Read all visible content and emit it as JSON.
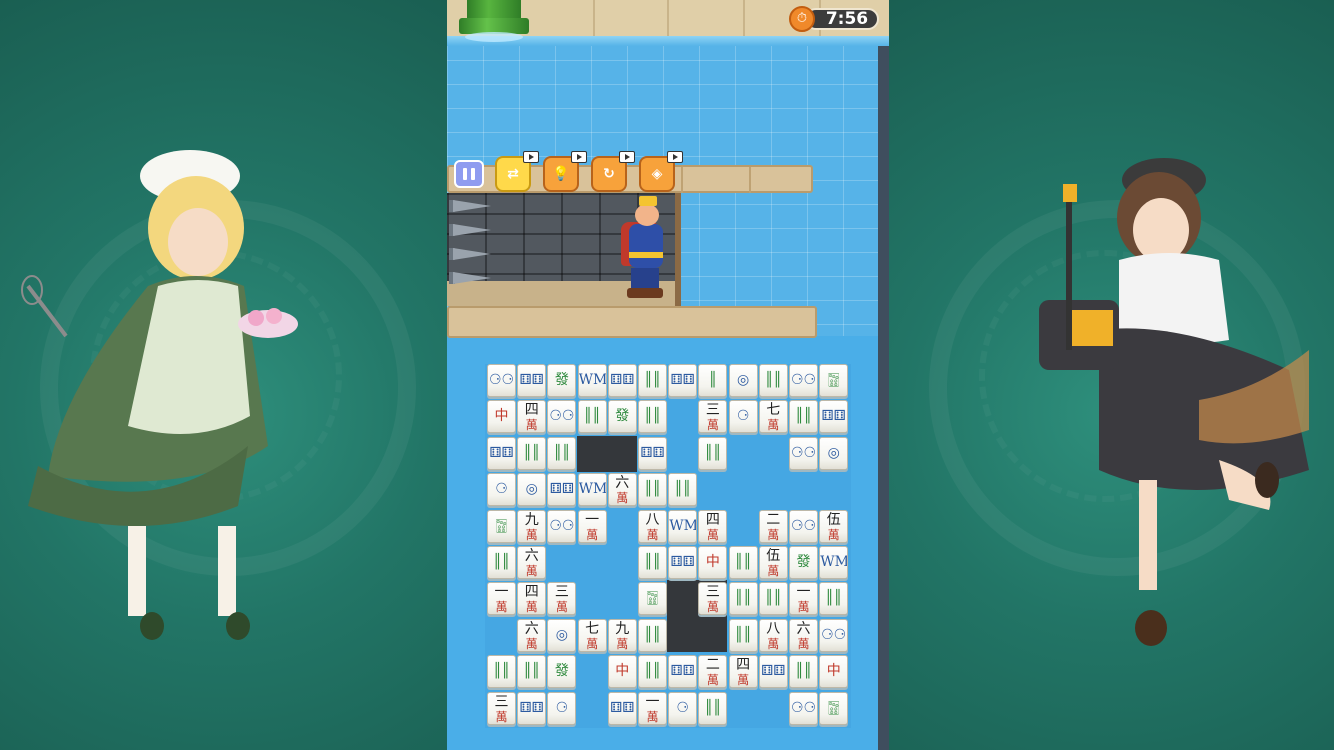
{
  "timer": {
    "value": "7:56"
  },
  "toolbar": {
    "items": [
      {
        "name": "pause-button"
      },
      {
        "name": "shuffle-tool",
        "icon": "shuffle-icon",
        "glyph": "⇄"
      },
      {
        "name": "hint-tool",
        "icon": "lightbulb-icon",
        "glyph": "💡"
      },
      {
        "name": "refresh-tool",
        "icon": "refresh-icon",
        "glyph": "↻"
      },
      {
        "name": "magnet-tool",
        "icon": "magnet-icon",
        "glyph": "◈"
      }
    ]
  },
  "tiles": [
    [
      "⚆⚆",
      "⚅⚅",
      "發",
      "WM",
      "⚅⚅",
      "║║",
      "⚅⚅",
      "║",
      "◎",
      "║║",
      "⚆⚆",
      "🀟"
    ],
    [
      "中",
      "四萬",
      "⚆⚆",
      "║║",
      "發",
      "║║",
      "",
      "三萬",
      "⚆",
      "七萬",
      "║║",
      "⚅⚅"
    ],
    [
      "⚅⚅",
      "║║",
      "║║",
      "",
      "",
      "⚅⚅",
      "",
      "║║",
      "",
      "",
      "⚆⚆",
      "◎"
    ],
    [
      "⚆",
      "◎",
      "⚅⚅",
      "WM",
      "六萬",
      "║║",
      "║║",
      "",
      "",
      "",
      "",
      ""
    ],
    [
      "🀟",
      "九萬",
      "⚆⚆",
      "一萬",
      "",
      "八萬",
      "WM",
      "四萬",
      "",
      "二萬",
      "⚆⚆",
      "伍萬"
    ],
    [
      "║║",
      "六萬",
      "",
      "",
      "",
      "║║",
      "⚅⚅",
      "中",
      "║║",
      "伍萬",
      "發",
      "WM"
    ],
    [
      "一萬",
      "四萬",
      "三萬",
      "",
      "",
      "🀟",
      "",
      "三萬",
      "║║",
      "║║",
      "一萬",
      "║║"
    ],
    [
      "",
      "六萬",
      "◎",
      "七萬",
      "九萬",
      "║║",
      "",
      "",
      "║║",
      "八萬",
      "六萬",
      "⚆⚆"
    ],
    [
      "║║",
      "║║",
      "發",
      "",
      "中",
      "║║",
      "⚅⚅",
      "二萬",
      "四萬",
      "⚅⚅",
      "║║",
      "中"
    ],
    [
      "三萬",
      "⚅⚅",
      "⚆",
      "",
      "⚅⚅",
      "一萬",
      "⚆",
      "║║",
      "",
      "",
      "⚆⚆",
      "🀟"
    ]
  ],
  "colors": {
    "board_water": "#4aaee8",
    "side_bg": "#227566",
    "tile_red": "#c0392b",
    "tile_green": "#2f8a3e"
  }
}
